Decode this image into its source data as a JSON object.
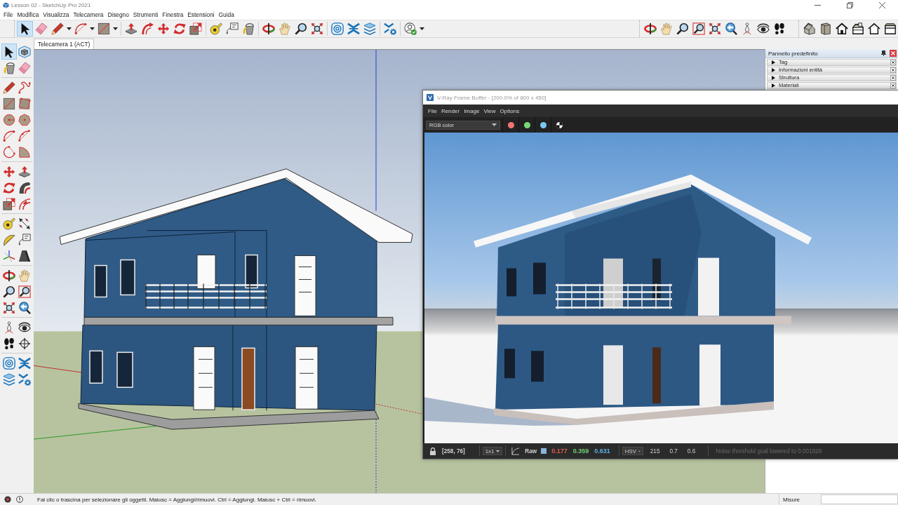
{
  "window": {
    "title": "Lesson 02 - SketchUp Pro 2021"
  },
  "menu_bar": [
    "File",
    "Modifica",
    "Visualizza",
    "Telecamera",
    "Disegno",
    "Strumenti",
    "Finestra",
    "Estensioni",
    "Guida"
  ],
  "main_toolbar": {
    "groups": [
      [
        {
          "selected": true,
          "dropdown": false
        },
        {
          "selected": false,
          "dropdown": false
        },
        {
          "selected": false,
          "dropdown": true
        },
        {
          "selected": false,
          "dropdown": true
        },
        {
          "selected": false,
          "dropdown": true
        }
      ],
      [
        {
          "selected": false,
          "dropdown": false
        },
        {
          "selected": false,
          "dropdown": false
        },
        {
          "selected": false,
          "dropdown": false
        },
        {
          "selected": false,
          "dropdown": false
        },
        {
          "selected": false,
          "dropdown": false
        }
      ],
      [
        {
          "selected": false,
          "dropdown": false
        },
        {
          "selected": false,
          "dropdown": false
        },
        {
          "selected": false,
          "dropdown": false
        }
      ],
      [
        {
          "selected": false,
          "dropdown": false
        },
        {
          "selected": false,
          "dropdown": false
        },
        {
          "selected": false,
          "dropdown": false
        },
        {
          "selected": false,
          "dropdown": false
        }
      ],
      [
        {
          "selected": false,
          "dropdown": false
        },
        {
          "selected": false,
          "dropdown": false
        },
        {
          "selected": false,
          "dropdown": false
        }
      ],
      [
        {
          "selected": false,
          "dropdown": false
        }
      ],
      [
        {
          "selected": false,
          "dropdown": true
        }
      ]
    ]
  },
  "camera_toolbar": {
    "tools": [
      {
        "selected": false
      },
      {
        "selected": false
      },
      {
        "selected": false
      },
      {
        "selected": false
      },
      {
        "selected": false
      },
      {
        "selected": false
      },
      {
        "selected": false
      },
      {
        "selected": false
      },
      {
        "selected": false
      }
    ]
  },
  "views_toolbar": {
    "tools": [
      {
        "selected": false
      },
      {
        "selected": false
      },
      {
        "selected": false
      },
      {
        "selected": false
      },
      {
        "selected": false
      },
      {
        "selected": false
      }
    ]
  },
  "scene_tabs": [
    {
      "label": "Telecamera 1 (ACT)",
      "selected": true
    }
  ],
  "side_toolbar": {
    "groups": [
      [
        {
          "selected": true
        },
        {
          "selected": false
        },
        {
          "selected": false
        },
        {
          "selected": false
        }
      ],
      [
        {
          "selected": false
        },
        {
          "selected": false
        },
        {
          "selected": false
        },
        {
          "selected": false
        },
        {
          "selected": false
        },
        {
          "selected": false
        },
        {
          "selected": false
        },
        {
          "selected": false
        },
        {
          "selected": false
        },
        {
          "selected": false
        }
      ],
      [
        {
          "selected": false
        },
        {
          "selected": false
        },
        {
          "selected": false
        },
        {
          "selected": false
        },
        {
          "selected": false
        },
        {
          "selected": false
        }
      ],
      [
        {
          "selected": false
        },
        {
          "selected": false
        },
        {
          "selected": false
        },
        {
          "selected": false
        },
        {
          "selected": false
        },
        {
          "selected": false
        }
      ],
      [
        {
          "selected": false
        },
        {
          "selected": false
        },
        {
          "selected": false
        },
        {
          "selected": false
        },
        {
          "selected": false
        },
        {
          "selected": false
        }
      ],
      [
        {
          "selected": false
        },
        {
          "selected": false
        },
        {
          "selected": false
        },
        {
          "selected": false
        }
      ],
      [
        {
          "selected": false
        },
        {
          "selected": false
        },
        {
          "selected": false
        },
        {
          "selected": false
        }
      ]
    ]
  },
  "tray": {
    "title": "Pannello predefinito",
    "panels": [
      {
        "label": "Tag",
        "expanded": false
      },
      {
        "label": "Informazioni entità",
        "expanded": false
      },
      {
        "label": "Struttura",
        "expanded": false
      },
      {
        "label": "Materiali",
        "expanded": false
      }
    ]
  },
  "frame_buffer": {
    "title": "V-Ray Frame Buffer - [200.0% of 800 x 450]",
    "menu": [
      "File",
      "Render",
      "Image",
      "View",
      "Options"
    ],
    "channel": "RGB color",
    "channel_toggles": [
      {
        "color": "#f07474"
      },
      {
        "color": "#78d878"
      },
      {
        "color": "#78c8f2"
      }
    ],
    "status": {
      "pixel": "[258, 76]",
      "zoom": "1x1",
      "mode": "Raw",
      "rgb_values": [
        {
          "value": "0.177",
          "color": "#e05a50"
        },
        {
          "value": "0.359",
          "color": "#72d072"
        },
        {
          "value": "0.631",
          "color": "#5ab0e8"
        }
      ],
      "color_space": "HSV",
      "hsv_values": [
        "215",
        "0.7",
        "0.6"
      ],
      "message": "Noise threshold goal lowered to 0.001828"
    }
  },
  "status_bar": {
    "hint": "Fai clic o trascina per selezionare gli oggetti. Maiusc = Aggiungi/rimuovi. Ctrl = Aggiungi. Maiusc + Ctrl = rimuovi.",
    "measurements_label": "Misure"
  }
}
